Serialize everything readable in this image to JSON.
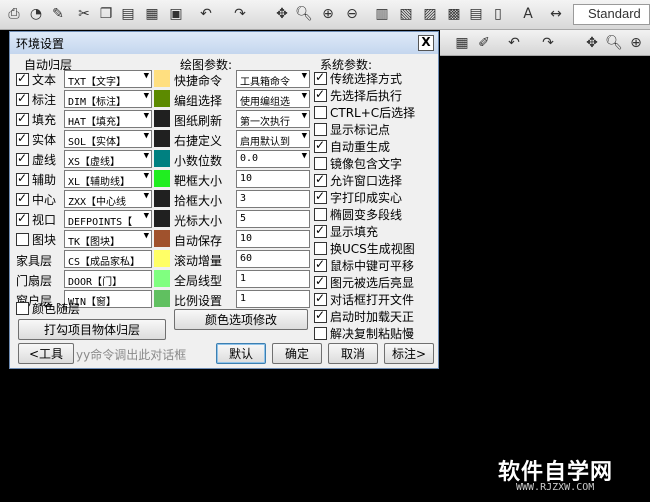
{
  "toolbar": {
    "style_value": "Standard"
  },
  "dialog": {
    "title": "环境设置",
    "close_label": "X",
    "auto_layer": {
      "header": "自动归层",
      "items": [
        {
          "label": "文本",
          "checked": true,
          "value": "TXT【文字】"
        },
        {
          "label": "标注",
          "checked": true,
          "value": "DIM【标注】"
        },
        {
          "label": "填充",
          "checked": true,
          "value": "HAT【填充】"
        },
        {
          "label": "实体",
          "checked": true,
          "value": "SOL【实体】"
        },
        {
          "label": "虚线",
          "checked": true,
          "value": "XS【虚线】"
        },
        {
          "label": "辅助",
          "checked": true,
          "value": "XL【辅助线】"
        },
        {
          "label": "中心",
          "checked": true,
          "value": "ZXX【中心线"
        },
        {
          "label": "视口",
          "checked": true,
          "value": "DEFPOINTS【"
        },
        {
          "label": "图块",
          "checked": false,
          "value": "TK【图块】"
        }
      ],
      "text_items": [
        {
          "label": "家具层",
          "value": "CS【成品家私】"
        },
        {
          "label": "门扇层",
          "value": "DOOR【门】"
        },
        {
          "label": "窗户层",
          "value": "WIN【窗】"
        }
      ],
      "color_follow_layer": {
        "label": "颜色随层",
        "checked": false
      },
      "apply_button": "打勾项目物体归层"
    },
    "drawing": {
      "header": "绘图参数:",
      "combo_items": [
        {
          "label": "快捷命令",
          "value": "工具箱命令"
        },
        {
          "label": "编组选择",
          "value": "使用编组选"
        },
        {
          "label": "图纸刷新",
          "value": "第一次执行"
        },
        {
          "label": "右捷定义",
          "value": "启用默认到"
        },
        {
          "label": "小数位数",
          "value": "0.0"
        }
      ],
      "text_items": [
        {
          "label": "靶框大小",
          "value": "10"
        },
        {
          "label": "拾框大小",
          "value": "3"
        },
        {
          "label": "光标大小",
          "value": "5"
        },
        {
          "label": "自动保存",
          "value": "10"
        },
        {
          "label": "滚动增量",
          "value": "60"
        },
        {
          "label": "全局线型",
          "value": "1"
        },
        {
          "label": "比例设置",
          "value": "1"
        }
      ],
      "color_button": "颜色选项修改"
    },
    "system": {
      "header": "系统参数:",
      "items": [
        {
          "label": "传统选择方式",
          "checked": true
        },
        {
          "label": "先选择后执行",
          "checked": true
        },
        {
          "label": "CTRL+C后选择",
          "checked": false
        },
        {
          "label": "显示标记点",
          "checked": false
        },
        {
          "label": "自动重生成",
          "checked": true
        },
        {
          "label": "镜像包含文字",
          "checked": false
        },
        {
          "label": "允许窗口选择",
          "checked": true
        },
        {
          "label": "字打印成实心",
          "checked": true
        },
        {
          "label": "椭圆变多段线",
          "checked": false
        },
        {
          "label": "显示填充",
          "checked": true
        },
        {
          "label": "换UCS生成视图",
          "checked": false
        },
        {
          "label": "鼠标中键可平移",
          "checked": true
        },
        {
          "label": "图元被选后亮显",
          "checked": true
        },
        {
          "label": "对话框打开文件",
          "checked": true
        },
        {
          "label": "启动时加载天正",
          "checked": true
        },
        {
          "label": "解决复制粘贴慢",
          "checked": false
        }
      ]
    },
    "footer": {
      "tools_button": "<工具",
      "hint": "yy命令调出此对话框",
      "default_button": "默认",
      "ok_button": "确定",
      "cancel_button": "取消",
      "annotate_button": "标注>"
    }
  },
  "colors": {
    "swatches_left": [
      "#ffdf80",
      "#5c8a00",
      "#202020",
      "#202020",
      "#008080",
      "#00ee00",
      "#202020",
      "#202020",
      "#ffff66",
      "#80ff80",
      "#80c060",
      "#60c060"
    ],
    "swatches_mid": [
      "#ffdf80",
      "#5c8a00",
      "#202020",
      "#202020",
      "#008080",
      "#20ee20",
      "#202020",
      "#202020",
      "#a0522d",
      "#ffff66",
      "#80ff80",
      "#60c060"
    ]
  },
  "watermark": {
    "main": "软件自学网",
    "sub": "WWW.RJZXW.COM"
  }
}
